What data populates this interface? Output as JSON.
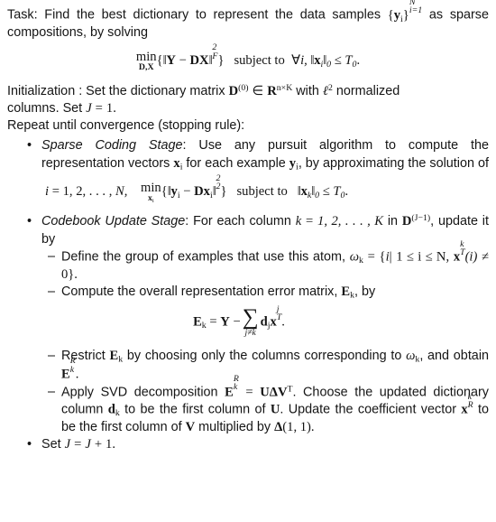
{
  "document": {
    "kind": "algorithm-description",
    "title_line": "Task: Find the best dictionary to represent the data samples",
    "task": {
      "lead": "Task: Find the best dictionary to represent the data samples",
      "set_open": "{",
      "set_var": "y",
      "set_sub": "i",
      "set_close": "}",
      "set_sup": "N",
      "set_lowlimit": "i=1",
      "tail_1": "as",
      "tail_2": "sparse compositions, by solving"
    },
    "eq_main": {
      "min_op": "min",
      "min_under": "D,X",
      "brace_open": "{",
      "norm_open": "‖",
      "Y": "Y",
      "minus": "−",
      "DX": "DX",
      "norm_close": "‖",
      "norm_sup": "2",
      "norm_sub": "F",
      "brace_close": "}",
      "subject_to": "subject to",
      "forall": "∀",
      "forall_var": "i,",
      "x_norm_open": "‖",
      "x_var": "x",
      "x_sub": "i",
      "x_norm_close": "‖",
      "x_norm_sub": "0",
      "le": "≤",
      "T": "T",
      "T_sub": "0",
      "period": "."
    },
    "initialization": {
      "line1_a": "Initialization : Set the dictionary matrix",
      "D": "D",
      "D_sup": "(0)",
      "in": "∈",
      "R": "R",
      "R_sup": "n×K",
      "line1_b": "with",
      "ell": "ℓ",
      "ell_sup": "2",
      "line1_c": "normalized",
      "line2_a": "columns. Set",
      "J": "J",
      "eq": "=",
      "one": "1.",
      "line3": "Repeat until convergence (stopping rule):"
    },
    "bullets": {
      "marker": "•",
      "dash": "–"
    },
    "sparse_coding": {
      "title": "Sparse Coding Stage",
      "colon": ":",
      "text_a": "Use any pursuit algorithm to compute the representation vectors",
      "x": "x",
      "x_sub": "i",
      "text_b": "for each example",
      "y": "y",
      "y_sub": "i",
      "text_c": ", by approximating the solution of",
      "eq": {
        "i": "i",
        "eq_sign": "=",
        "list": "1, 2, . . . ,",
        "N": "N,",
        "min_op": "min",
        "min_under": "x",
        "min_under_sub": "i",
        "brace_open": "{",
        "norm_open": "‖",
        "y": "y",
        "y_sub": "i",
        "minus": "−",
        "D": "D",
        "x": "x",
        "x_sub": "i",
        "norm_close": "‖",
        "norm_sup": "2",
        "norm_sub": "2",
        "brace_close": "}",
        "subject_to": "subject to",
        "x2_norm_open": "‖",
        "x2": "x",
        "x2_sub": "k",
        "x2_norm_close": "‖",
        "x2_norm_sub": "0",
        "le": "≤",
        "T": "T",
        "T_sub": "0",
        "period": "."
      }
    },
    "codebook_update": {
      "title": "Codebook Update Stage",
      "colon": ":",
      "text_a": "For each column",
      "k": "k",
      "eq_sign": "=",
      "list": "1, 2, . . . , K",
      "in": "in",
      "D": "D",
      "D_sup": "(J−1)",
      "comma": ",",
      "text_b": "update it by",
      "sub_items": [
        {
          "id": "define-group",
          "text_a": "Define the group of examples that use this atom,",
          "omega": "ω",
          "omega_sub": "k",
          "eq": "=",
          "brace_open": "{",
          "i": "i",
          "bar": "|",
          "range": "1 ≤ i ≤ N,",
          "x": "x",
          "x_sub": "T",
          "x_sup": "k",
          "arg": "(i)",
          "neq": "≠",
          "zero": "0",
          "brace_close": "}."
        },
        {
          "id": "compute-error",
          "text_a": "Compute the overall representation error matrix,",
          "E": "E",
          "E_sub": "k",
          "text_b": ", by"
        },
        {
          "id": "restrict",
          "text_a": "Restrict",
          "E": "E",
          "E_sub": "k",
          "text_b": "by choosing only the columns corresponding to",
          "omega": "ω",
          "omega_sub": "k",
          "text_c": ", and obtain",
          "E2": "E",
          "E2_sub": "k",
          "E2_sup": "R",
          "period": "."
        },
        {
          "id": "apply-svd",
          "text_a": "Apply SVD decomposition",
          "E": "E",
          "E_sub": "k",
          "E_sup": "R",
          "eq": "=",
          "U": "U",
          "Delta": "Δ",
          "V": "V",
          "V_sup": "T",
          "text_b": ". Choose the updated dictionary column",
          "d": "d",
          "d_sub": "k",
          "text_c": "to be the first column of",
          "U2": "U",
          "text_d": ". Update the coefficient vector",
          "x": "x",
          "x_sub": "R",
          "x_sup": "k",
          "text_e": "to be the first column of",
          "V2": "V",
          "text_f": "multiplied by",
          "Delta2": "Δ",
          "Delta_args": "(1, 1).",
          "period": "."
        }
      ]
    },
    "eq_error": {
      "E": "E",
      "E_sub": "k",
      "eq": "=",
      "Y": "Y",
      "minus": "−",
      "sum": "∑",
      "sum_lim": "j≠k",
      "d": "d",
      "d_sub": "j",
      "x": "x",
      "x_sub": "T",
      "x_sup": "j",
      "period": "."
    },
    "set_j": {
      "text": "Set",
      "J": "J",
      "eq": "=",
      "J2": "J",
      "plus": "+",
      "one": "1."
    },
    "colors": {
      "background": "#ffffff",
      "text": "#151515",
      "math": "#141414"
    }
  }
}
